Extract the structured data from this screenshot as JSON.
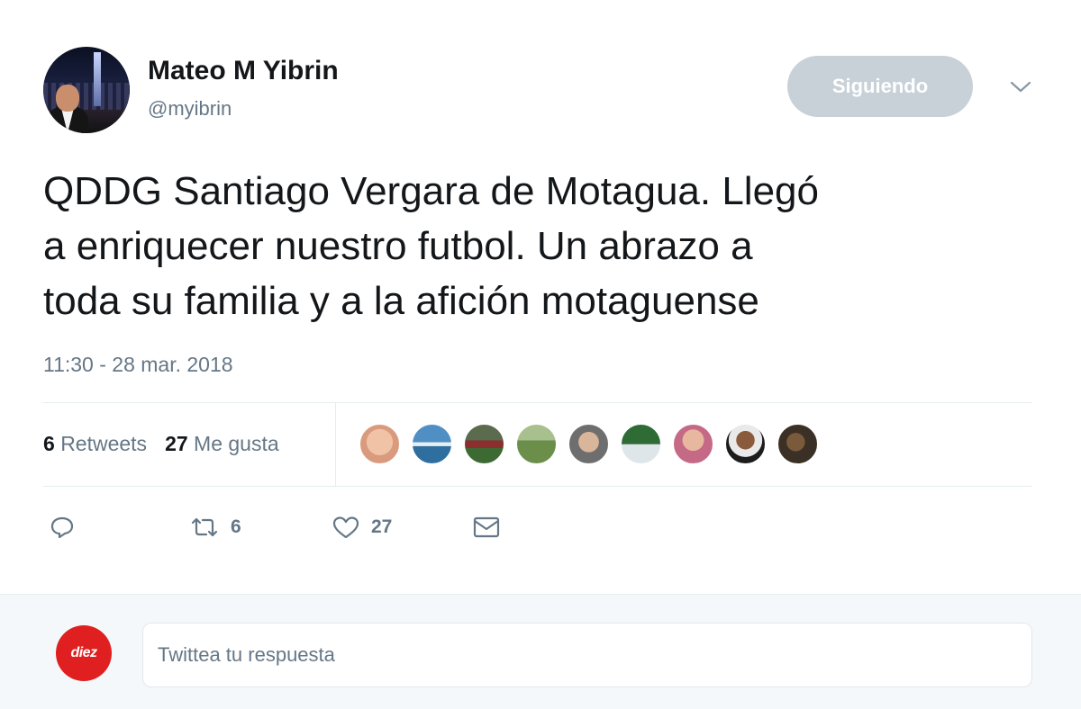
{
  "tweet": {
    "author_name": "Mateo M Yibrin",
    "author_handle": "@myibrin",
    "follow_label": "Siguiendo",
    "text_lines": [
      "QDDG Santiago Vergara de Motagua.  Llegó",
      "a enriquecer nuestro futbol.  Un abrazo a",
      "toda su familia y a la afición motaguense"
    ],
    "timestamp": "11:30 - 28 mar. 2018",
    "stats": {
      "retweets_count": "6",
      "retweets_label": "Retweets",
      "likes_count": "27",
      "likes_label": "Me gusta"
    },
    "actions": {
      "retweet_count": "6",
      "like_count": "27"
    }
  },
  "reply": {
    "placeholder": "Twittea tu respuesta",
    "avatar_text": "diez"
  },
  "colors": {
    "follow_button_bg": "#c8d1d8",
    "muted_text": "#657786",
    "brand_red": "#e02020"
  }
}
